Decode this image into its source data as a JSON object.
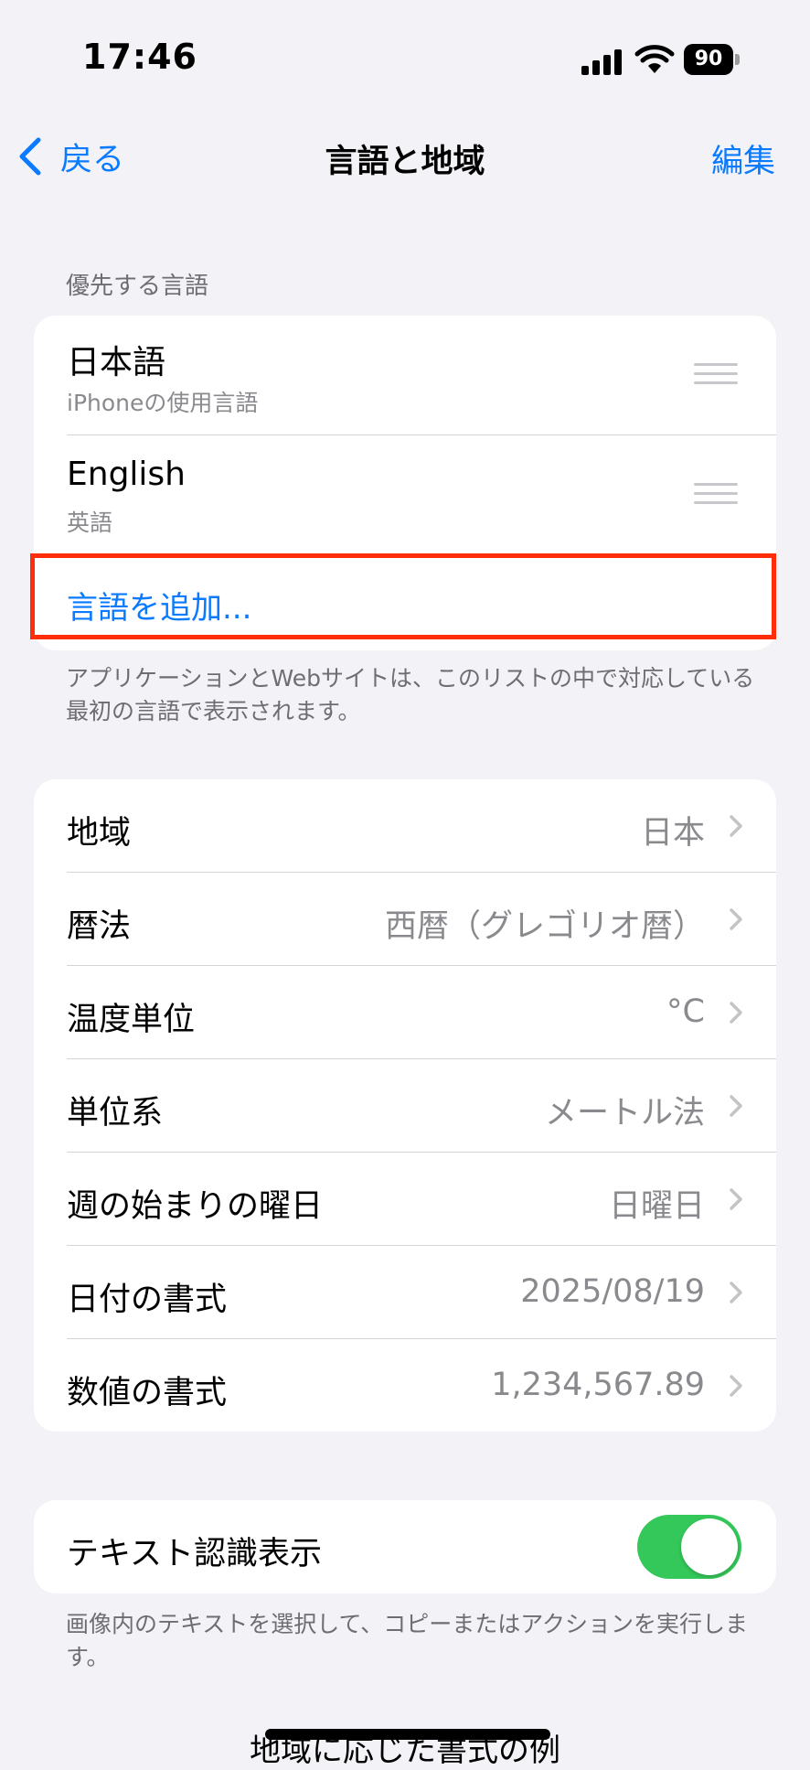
{
  "status": {
    "time": "17:46",
    "battery": "90"
  },
  "nav": {
    "back_label": "戻る",
    "title": "言語と地域",
    "edit_label": "編集"
  },
  "languages": {
    "header": "優先する言語",
    "items": [
      {
        "name": "日本語",
        "subtitle": "iPhoneの使用言語"
      },
      {
        "name": "English",
        "subtitle": "英語"
      }
    ],
    "add_label": "言語を追加...",
    "footer": "アプリケーションとWebサイトは、このリストの中で対応している最初の言語で表示されます。"
  },
  "settings": {
    "items": [
      {
        "label": "地域",
        "value": "日本"
      },
      {
        "label": "暦法",
        "value": "西暦（グレゴリオ暦）"
      },
      {
        "label": "温度単位",
        "value": "°C"
      },
      {
        "label": "単位系",
        "value": "メートル法"
      },
      {
        "label": "週の始まりの曜日",
        "value": "日曜日"
      },
      {
        "label": "日付の書式",
        "value": "2025/08/19"
      },
      {
        "label": "数値の書式",
        "value": "1,234,567.89"
      }
    ]
  },
  "live_text": {
    "label": "テキスト認識表示",
    "enabled": true,
    "footer": "画像内のテキストを選択して、コピーまたはアクションを実行します。"
  },
  "format_example": {
    "title": "地域に応じた書式の例"
  },
  "colors": {
    "accent": "#0a7aff",
    "toggle_on": "#34c759",
    "highlight": "#ff2d0a",
    "background": "#f2f2f7"
  }
}
